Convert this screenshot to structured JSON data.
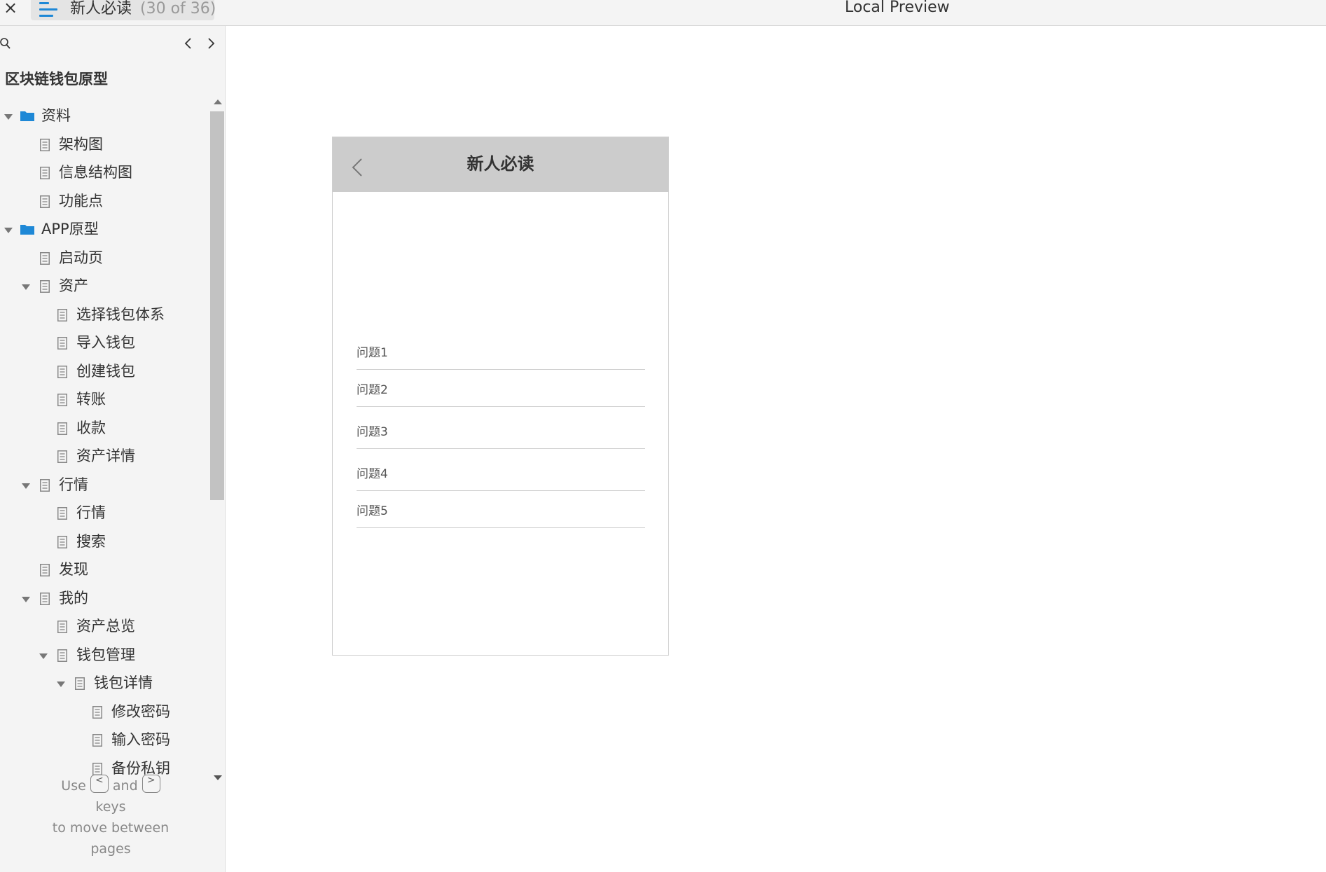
{
  "topbar": {
    "close_label": "×",
    "page_title": "新人必读",
    "page_count": "(30 of 36)",
    "preview_label": "Local Preview"
  },
  "sidebar": {
    "project_title": "区块链钱包原型",
    "tree": [
      {
        "label": "资料",
        "type": "folder",
        "level": 0,
        "expanded": true
      },
      {
        "label": "架构图",
        "type": "page",
        "level": 1
      },
      {
        "label": "信息结构图",
        "type": "page",
        "level": 1
      },
      {
        "label": "功能点",
        "type": "page",
        "level": 1
      },
      {
        "label": "APP原型",
        "type": "folder",
        "level": 0,
        "expanded": true
      },
      {
        "label": "启动页",
        "type": "page",
        "level": 1
      },
      {
        "label": "资产",
        "type": "page",
        "level": 1,
        "expanded": true
      },
      {
        "label": "选择钱包体系",
        "type": "page",
        "level": 2
      },
      {
        "label": "导入钱包",
        "type": "page",
        "level": 2
      },
      {
        "label": "创建钱包",
        "type": "page",
        "level": 2
      },
      {
        "label": "转账",
        "type": "page",
        "level": 2
      },
      {
        "label": "收款",
        "type": "page",
        "level": 2
      },
      {
        "label": "资产详情",
        "type": "page",
        "level": 2
      },
      {
        "label": "行情",
        "type": "page",
        "level": 1,
        "expanded": true
      },
      {
        "label": "行情",
        "type": "page",
        "level": 2
      },
      {
        "label": "搜索",
        "type": "page",
        "level": 2
      },
      {
        "label": "发现",
        "type": "page",
        "level": 1
      },
      {
        "label": "我的",
        "type": "page",
        "level": 1,
        "expanded": true
      },
      {
        "label": "资产总览",
        "type": "page",
        "level": 2
      },
      {
        "label": "钱包管理",
        "type": "page",
        "level": 2,
        "expanded": true
      },
      {
        "label": "钱包详情",
        "type": "page",
        "level": 3,
        "expanded": true
      },
      {
        "label": "修改密码",
        "type": "page",
        "level": 4
      },
      {
        "label": "输入密码",
        "type": "page",
        "level": 4
      },
      {
        "label": "备份私钥",
        "type": "page",
        "level": 4
      }
    ],
    "help": {
      "use": "Use",
      "prev_key": "<",
      "and": "and",
      "next_key": ">",
      "line2": "keys",
      "line3": "to move between",
      "line4": "pages"
    }
  },
  "phone": {
    "title": "新人必读",
    "questions": [
      "问题1",
      "问题2",
      "问题3",
      "问题4",
      "问题5"
    ]
  },
  "colors": {
    "accent_blue": "#1e88d6",
    "header_gray": "#cccccc",
    "sidebar_bg": "#f4f4f4"
  },
  "icons": {
    "close": "close-icon",
    "menu": "menu-icon",
    "search": "search-icon",
    "prev": "chevron-left-icon",
    "next": "chevron-right-icon",
    "folder": "folder-icon",
    "page": "page-icon",
    "back": "back-chevron-icon"
  }
}
